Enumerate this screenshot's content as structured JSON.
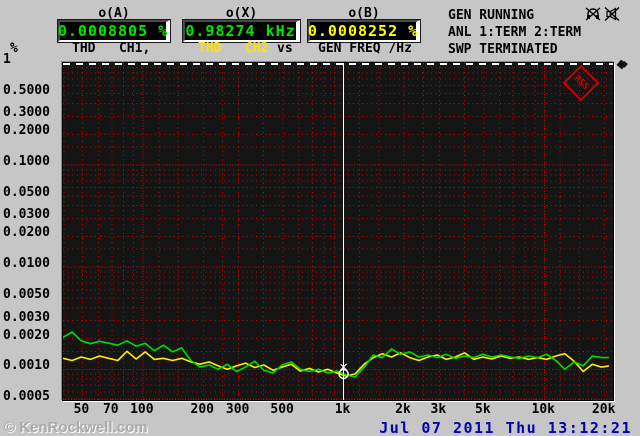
{
  "window": {
    "bg": "#c6c6c6"
  },
  "header": {
    "meters": [
      {
        "caption": "o(A)",
        "value": "0.0008805 %",
        "color": "#00e400"
      },
      {
        "caption": "o(X)",
        "value": "0.98274 kHz",
        "color": "#00e400"
      },
      {
        "caption": "o(B)",
        "value": "0.0008252 %",
        "color": "#ffff00"
      }
    ],
    "y_unit": "%",
    "trace_row": {
      "ch1_label": "THD   CH1,",
      "ch2_label": "THD   CH2",
      "vs_label": "vs",
      "x_axis_label": "GEN FREQ /Hz"
    },
    "status": {
      "line1": "GEN RUNNING",
      "line2": "ANL 1:TERM 2:TERM",
      "line3": "SWP TERMINATED"
    },
    "icons": [
      "headphones-muted",
      "speaker-muted"
    ]
  },
  "plot": {
    "logo_text": "R&S",
    "logo_color": "#c80000",
    "grid_color": "#d40000",
    "bg_color": "#151515",
    "cursor_color": "#ffffff"
  },
  "chart_data": {
    "type": "line",
    "x_scale": "log",
    "y_scale": "log",
    "xlim": [
      40,
      22000
    ],
    "ylim": [
      0.0005,
      1
    ],
    "xlabel": "GEN FREQ /Hz",
    "ylabel": "THD %",
    "grid": true,
    "cursor": {
      "x": 1000,
      "marker_y": 0.0009
    },
    "x": [
      40,
      44.4,
      49.3,
      54.8,
      60.8,
      67.5,
      75,
      83.3,
      92.5,
      102.7,
      114,
      126.6,
      140.6,
      156.1,
      173.3,
      192.5,
      213.7,
      237.3,
      263.5,
      292.6,
      324.9,
      360.7,
      400.5,
      444.7,
      493.8,
      548.3,
      608.8,
      676,
      750.6,
      833.4,
      925.4,
      1027,
      1141,
      1267,
      1406,
      1562,
      1734,
      1925,
      2138,
      2374,
      2636,
      2927,
      3250,
      3609,
      4007,
      4449,
      4940,
      5485,
      6091,
      6763,
      7509,
      8338,
      9258,
      10280,
      11414,
      12674,
      14072,
      15625,
      17349,
      19263,
      21000
    ],
    "series": [
      {
        "name": "THD CH1",
        "color": "#00dc00",
        "values": [
          0.00205,
          0.00232,
          0.0019,
          0.00178,
          0.00188,
          0.0018,
          0.00172,
          0.0019,
          0.00168,
          0.0018,
          0.00152,
          0.00172,
          0.00148,
          0.00162,
          0.00122,
          0.00105,
          0.0011,
          0.001,
          0.00112,
          0.00095,
          0.00105,
          0.0012,
          0.00098,
          0.00092,
          0.0011,
          0.00118,
          0.001,
          0.00095,
          0.001,
          0.00092,
          0.00096,
          0.00088,
          0.00084,
          0.00105,
          0.00138,
          0.0013,
          0.00158,
          0.0014,
          0.00148,
          0.00132,
          0.00138,
          0.0013,
          0.0014,
          0.00128,
          0.00135,
          0.0013,
          0.0014,
          0.00132,
          0.00138,
          0.00132,
          0.00128,
          0.00135,
          0.0013,
          0.0014,
          0.00122,
          0.001,
          0.00118,
          0.00108,
          0.00135,
          0.0013,
          0.0013
        ]
      },
      {
        "name": "THD CH2",
        "color": "#ffee00",
        "values": [
          0.00128,
          0.00122,
          0.00132,
          0.00125,
          0.00135,
          0.00128,
          0.00122,
          0.0015,
          0.00126,
          0.00148,
          0.00125,
          0.00128,
          0.00122,
          0.00128,
          0.00118,
          0.00112,
          0.00118,
          0.00108,
          0.001,
          0.00108,
          0.00115,
          0.00104,
          0.0011,
          0.00098,
          0.00105,
          0.00112,
          0.00096,
          0.00102,
          0.00094,
          0.001,
          0.00092,
          0.00086,
          0.0009,
          0.00112,
          0.0013,
          0.00142,
          0.00132,
          0.00145,
          0.0013,
          0.00122,
          0.00132,
          0.00138,
          0.00125,
          0.00132,
          0.00145,
          0.00125,
          0.00132,
          0.00126,
          0.00135,
          0.00128,
          0.00132,
          0.00125,
          0.0013,
          0.00125,
          0.00135,
          0.00142,
          0.0012,
          0.00095,
          0.00112,
          0.00105,
          0.00108
        ]
      }
    ],
    "y_ticks": [
      {
        "label": "1",
        "value": 1
      },
      {
        "label": "0.5000",
        "value": 0.5
      },
      {
        "label": "0.3000",
        "value": 0.3
      },
      {
        "label": "0.2000",
        "value": 0.2
      },
      {
        "label": "0.1000",
        "value": 0.1
      },
      {
        "label": "0.0500",
        "value": 0.05
      },
      {
        "label": "0.0300",
        "value": 0.03
      },
      {
        "label": "0.0200",
        "value": 0.02
      },
      {
        "label": "0.0100",
        "value": 0.01
      },
      {
        "label": "0.0050",
        "value": 0.005
      },
      {
        "label": "0.0030",
        "value": 0.003
      },
      {
        "label": "0.0020",
        "value": 0.002
      },
      {
        "label": "0.0010",
        "value": 0.001
      },
      {
        "label": "0.0005",
        "value": 0.0005
      }
    ],
    "x_ticks": [
      {
        "label": "50",
        "value": 50
      },
      {
        "label": "70",
        "value": 70
      },
      {
        "label": "100",
        "value": 100
      },
      {
        "label": "200",
        "value": 200
      },
      {
        "label": "300",
        "value": 300
      },
      {
        "label": "500",
        "value": 500
      },
      {
        "label": "1k",
        "value": 1000
      },
      {
        "label": "2k",
        "value": 2000
      },
      {
        "label": "3k",
        "value": 3000
      },
      {
        "label": "5k",
        "value": 5000
      },
      {
        "label": "10k",
        "value": 10000
      },
      {
        "label": "20k",
        "value": 20000
      }
    ]
  },
  "footer": {
    "watermark": "© KenRockwell.com",
    "timestamp": "Jul 07 2011 Thu 13:12:21",
    "timestamp_color": "#0000b4"
  }
}
